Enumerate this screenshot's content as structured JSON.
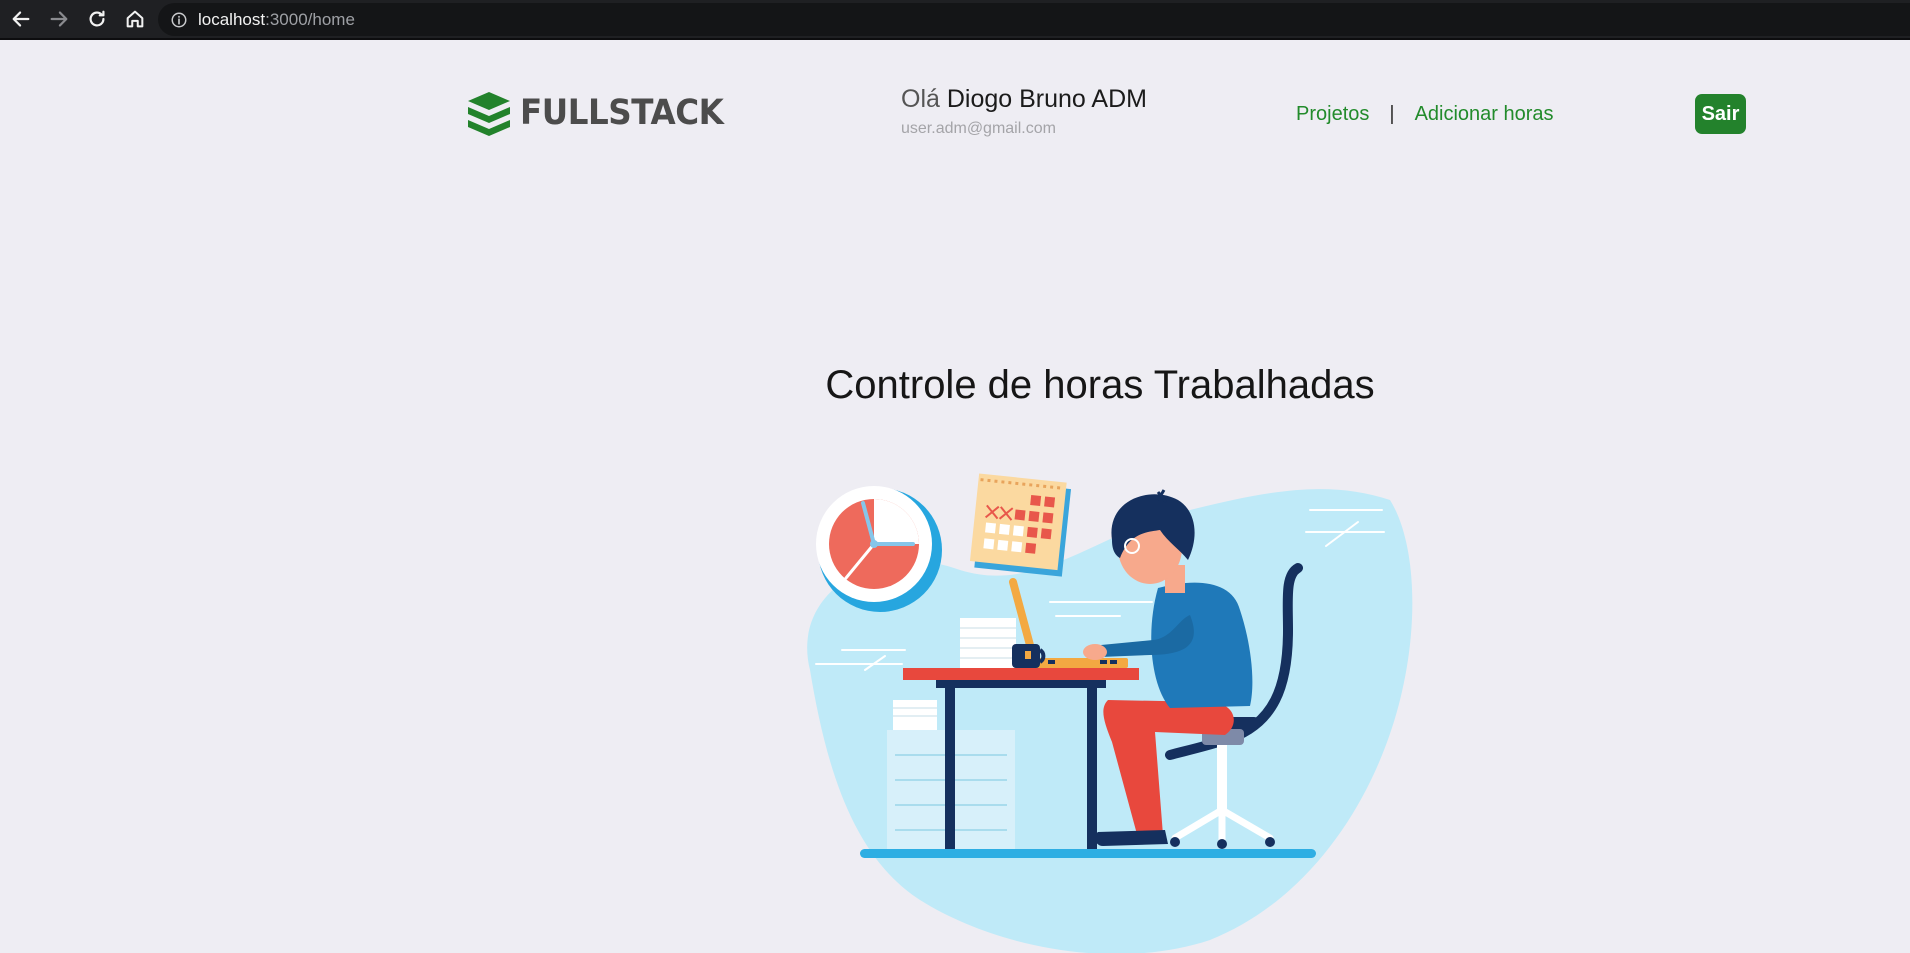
{
  "browser": {
    "url_host": "localhost",
    "url_rest": ":3000/home",
    "icons": [
      "back-arrow-icon",
      "forward-arrow-icon",
      "reload-icon",
      "home-icon",
      "info-icon"
    ]
  },
  "header": {
    "logo_text": "FULLSTACK",
    "greeting_prefix": "Olá",
    "user_name": "Diogo Bruno ADM",
    "user_email": "user.adm@gmail.com",
    "nav": {
      "projects": "Projetos",
      "separator": "|",
      "add_hours": "Adicionar horas"
    },
    "logout_label": "Sair"
  },
  "main": {
    "title": "Controle de horas Trabalhadas"
  },
  "colors": {
    "accent": "#23822c",
    "link": "#228b2b",
    "background": "#eeedf3"
  }
}
